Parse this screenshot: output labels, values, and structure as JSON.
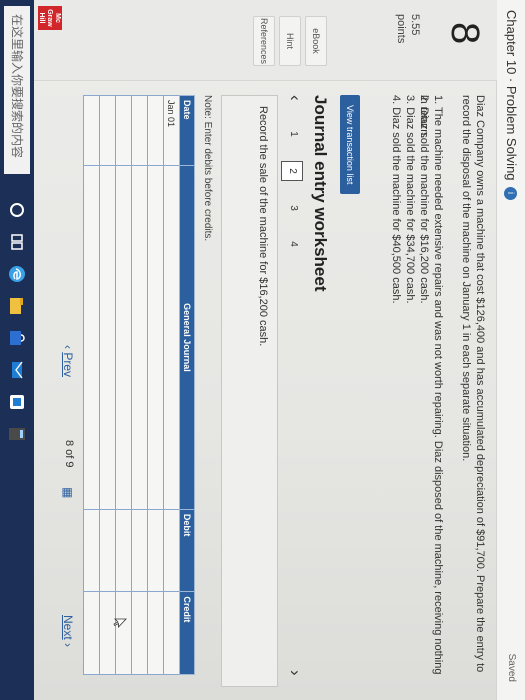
{
  "header": {
    "chapter_title": "Chapter 10 · Problem Solving",
    "info_icon": "i",
    "status": "Saved"
  },
  "question": {
    "number": "8",
    "points_value": "5.55",
    "points_label": "points",
    "side_links": [
      "eBook",
      "Hint",
      "References"
    ]
  },
  "prompt": "Diaz Company owns a machine that cost $126,400 and has accumulated depreciation of $91,700. Prepare the entry to record the disposal of the machine on January 1 in each separate situation.",
  "situations": [
    "1. The machine needed extensive repairs and was not worth repairing. Diaz disposed of the machine, receiving nothing in return.",
    "2. Diaz sold the machine for $16,200 cash.",
    "3. Diaz sold the machine for $34,700 cash.",
    "4. Diaz sold the machine for $40,500 cash."
  ],
  "view_button": "View transaction list",
  "worksheet": {
    "title": "Journal entry worksheet",
    "pages": [
      "1",
      "2",
      "3",
      "4"
    ],
    "active_page": "2",
    "instruction": "Record the sale of the machine for $16,200 cash.",
    "note": "Note: Enter debits before credits.",
    "columns": [
      "Date",
      "General Journal",
      "Debit",
      "Credit"
    ],
    "rows": [
      [
        "Jan 01",
        "",
        "",
        ""
      ],
      [
        "",
        "",
        "",
        ""
      ],
      [
        "",
        "",
        "",
        ""
      ],
      [
        "",
        "",
        "",
        ""
      ],
      [
        "",
        "",
        "",
        ""
      ],
      [
        "",
        "",
        "",
        ""
      ]
    ]
  },
  "navigation": {
    "prev_label": "Prev",
    "page_indicator": "8 of 9",
    "next_label": "Next"
  },
  "taskbar": {
    "search_placeholder": "在这里输入你要搜索的内容"
  },
  "brand": {
    "logo_lines": [
      "Mc",
      "Graw",
      "Hill"
    ]
  },
  "colors": {
    "accent": "#2b5f9e",
    "taskbar": "#1c2f57",
    "brand": "#d1262a"
  }
}
